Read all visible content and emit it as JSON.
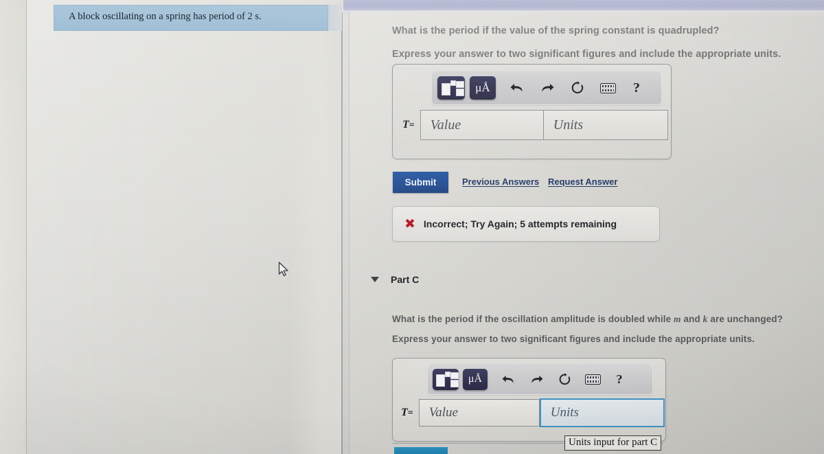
{
  "sidebar": {
    "problem_statement": "A block oscillating on a spring has period of 2 s."
  },
  "part_b": {
    "question": "What is the period if the value of the spring constant is quadrupled?",
    "instruction": "Express your answer to two significant figures and include the appropriate units.",
    "toolbar": {
      "template_icon": "math-template-icon",
      "units_icon": "micro-angstrom-units-icon",
      "undo_icon": "undo-arrow-icon",
      "redo_icon": "redo-arrow-icon",
      "reset_icon": "reset-circle-icon",
      "keyboard_icon": "keyboard-icon",
      "help_icon": "help-question-icon",
      "units_label": "μÅ",
      "help_label": "?"
    },
    "equation_label": "T",
    "equals": "=",
    "value_placeholder": "Value",
    "units_placeholder": "Units",
    "submit_label": "Submit",
    "previous_answers_label": "Previous Answers",
    "request_answer_label": "Request Answer",
    "feedback": {
      "icon": "incorrect-x-icon",
      "mark": "✖",
      "text": "Incorrect; Try Again; 5 attempts remaining"
    }
  },
  "part_c": {
    "collapse_icon": "collapse-triangle-icon",
    "label": "Part C",
    "question_pre": "What is the period if the oscillation amplitude is doubled while ",
    "question_var1": "m",
    "question_mid": " and ",
    "question_var2": "k",
    "question_post": " are unchanged?",
    "instruction": "Express your answer to two significant figures and include the appropriate units.",
    "toolbar": {
      "units_label": "μÅ",
      "help_label": "?"
    },
    "equation_label": "T",
    "equals": "=",
    "value_placeholder": "Value",
    "units_placeholder": "Units",
    "tooltip": "Units input for part C"
  },
  "colors": {
    "submit_blue": "#18458d",
    "link_blue": "#17305f",
    "error_red": "#b00b16",
    "focus_border": "#3f91c4",
    "highlight_blue": "#a4c2d8",
    "toolbar_dark": "#31314f",
    "top_band": "#b4b7d2"
  }
}
